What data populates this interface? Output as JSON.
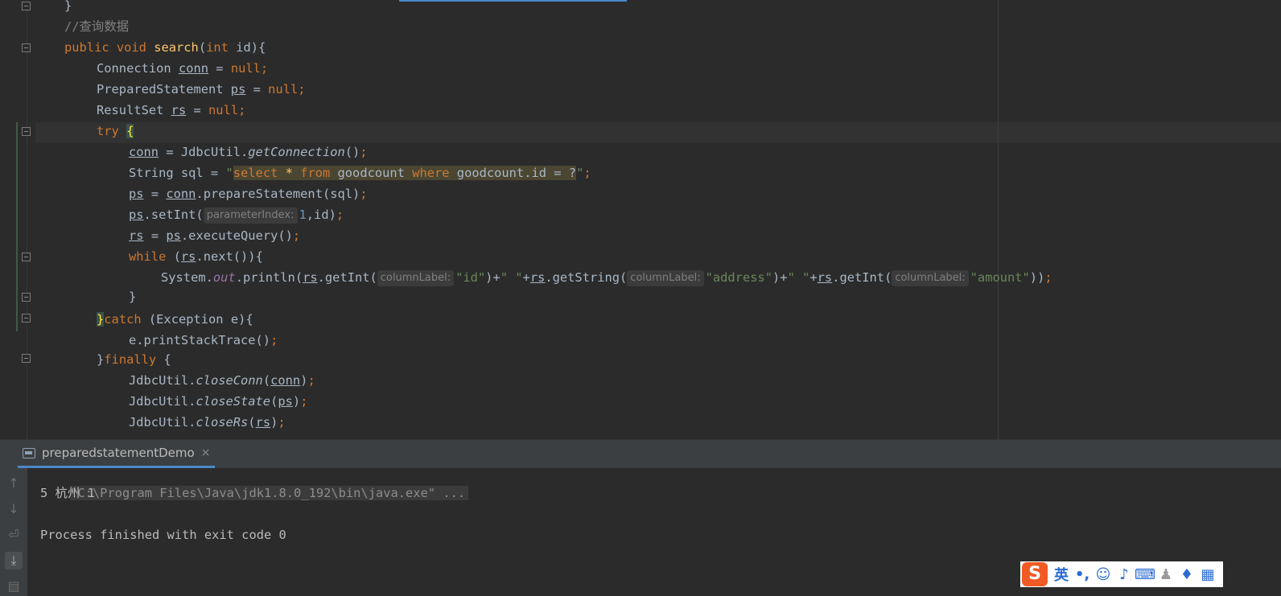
{
  "editor": {
    "lines": [
      {
        "id": "l0",
        "segments": [
          {
            "t": "}",
            "c": ""
          }
        ]
      },
      {
        "id": "l1",
        "segments": [
          {
            "t": "//查询数据",
            "c": "cm"
          }
        ]
      },
      {
        "id": "l2",
        "segments": [
          {
            "t": "public ",
            "c": "kw"
          },
          {
            "t": "void ",
            "c": "kw"
          },
          {
            "t": "search",
            "c": "fn"
          },
          {
            "t": "(",
            "c": ""
          },
          {
            "t": "int ",
            "c": "kw"
          },
          {
            "t": "id){",
            "c": ""
          }
        ]
      },
      {
        "id": "l3",
        "segments": [
          {
            "t": "Connection ",
            "c": ""
          },
          {
            "t": "conn",
            "c": "ul"
          },
          {
            "t": " = ",
            "c": ""
          },
          {
            "t": "null",
            "c": "kw"
          },
          {
            "t": ";",
            "c": "kw"
          }
        ]
      },
      {
        "id": "l4",
        "segments": [
          {
            "t": "PreparedStatement ",
            "c": ""
          },
          {
            "t": "ps",
            "c": "ul"
          },
          {
            "t": " = ",
            "c": ""
          },
          {
            "t": "null",
            "c": "kw"
          },
          {
            "t": ";",
            "c": "kw"
          }
        ]
      },
      {
        "id": "l5",
        "segments": [
          {
            "t": "ResultSet ",
            "c": ""
          },
          {
            "t": "rs",
            "c": "ul"
          },
          {
            "t": " = ",
            "c": ""
          },
          {
            "t": "null",
            "c": "kw"
          },
          {
            "t": ";",
            "c": "kw"
          }
        ]
      },
      {
        "id": "l6",
        "segments": [
          {
            "t": "try ",
            "c": "kw"
          },
          {
            "t": "{",
            "c": "brace-hl"
          }
        ]
      },
      {
        "id": "l7",
        "segments": [
          {
            "t": "conn",
            "c": "ul"
          },
          {
            "t": " = JdbcUtil.",
            "c": ""
          },
          {
            "t": "getConnection",
            "c": "it"
          },
          {
            "t": "()",
            "c": ""
          },
          {
            "t": ";",
            "c": "kw"
          }
        ]
      },
      {
        "id": "l8",
        "segments": [
          {
            "t": "String sql = ",
            "c": ""
          },
          {
            "t": "\"",
            "c": "str"
          },
          {
            "t": "select",
            "c": "sqlkw sql-bg"
          },
          {
            "t": " * ",
            "c": "sql-bg fnlike"
          },
          {
            "t": "from",
            "c": "sqlkw sql-bg"
          },
          {
            "t": " goodcount ",
            "c": "sql-bg"
          },
          {
            "t": "where",
            "c": "sqlkw sql-bg"
          },
          {
            "t": " goodcount.id = ?",
            "c": "sql-bg"
          },
          {
            "t": "\"",
            "c": "str"
          },
          {
            "t": ";",
            "c": "kw"
          }
        ]
      },
      {
        "id": "l9",
        "segments": [
          {
            "t": "ps",
            "c": "ul"
          },
          {
            "t": " = ",
            "c": ""
          },
          {
            "t": "conn",
            "c": "ul"
          },
          {
            "t": ".prepareStatement(sql)",
            "c": ""
          },
          {
            "t": ";",
            "c": "kw"
          }
        ]
      },
      {
        "id": "l10",
        "segments": [
          {
            "t": "ps",
            "c": "ul"
          },
          {
            "t": ".setInt(",
            "c": ""
          },
          {
            "t": "parameterIndex:",
            "c": "hint"
          },
          {
            "t": "1",
            "c": "num"
          },
          {
            "t": ",id)",
            "c": ""
          },
          {
            "t": ";",
            "c": "kw"
          }
        ]
      },
      {
        "id": "l11",
        "segments": [
          {
            "t": "rs",
            "c": "ul"
          },
          {
            "t": " = ",
            "c": ""
          },
          {
            "t": "ps",
            "c": "ul"
          },
          {
            "t": ".executeQuery()",
            "c": ""
          },
          {
            "t": ";",
            "c": "kw"
          }
        ]
      },
      {
        "id": "l12",
        "segments": [
          {
            "t": "while ",
            "c": "kw"
          },
          {
            "t": "(",
            "c": ""
          },
          {
            "t": "rs",
            "c": "ul"
          },
          {
            "t": ".next()){",
            "c": ""
          }
        ]
      },
      {
        "id": "l13",
        "segments": [
          {
            "t": "System.",
            "c": ""
          },
          {
            "t": "out",
            "c": "static"
          },
          {
            "t": ".println(",
            "c": ""
          },
          {
            "t": "rs",
            "c": "ul"
          },
          {
            "t": ".getInt(",
            "c": ""
          },
          {
            "t": "columnLabel:",
            "c": "hint"
          },
          {
            "t": "\"id\"",
            "c": "str"
          },
          {
            "t": ")+",
            "c": ""
          },
          {
            "t": "\" \"",
            "c": "str"
          },
          {
            "t": "+",
            "c": ""
          },
          {
            "t": "rs",
            "c": "ul"
          },
          {
            "t": ".getString(",
            "c": ""
          },
          {
            "t": "columnLabel:",
            "c": "hint"
          },
          {
            "t": "\"address\"",
            "c": "str"
          },
          {
            "t": ")+",
            "c": ""
          },
          {
            "t": "\" \"",
            "c": "str"
          },
          {
            "t": "+",
            "c": ""
          },
          {
            "t": "rs",
            "c": "ul"
          },
          {
            "t": ".getInt(",
            "c": ""
          },
          {
            "t": "columnLabel:",
            "c": "hint"
          },
          {
            "t": "\"amount\"",
            "c": "str"
          },
          {
            "t": "))",
            "c": ""
          },
          {
            "t": ";",
            "c": "kw"
          }
        ]
      },
      {
        "id": "l14",
        "segments": [
          {
            "t": "}",
            "c": ""
          }
        ]
      },
      {
        "id": "l15",
        "segments": [
          {
            "t": "}",
            "c": "brace-hl"
          },
          {
            "t": "catch ",
            "c": "kw"
          },
          {
            "t": "(Exception e){",
            "c": ""
          }
        ]
      },
      {
        "id": "l16",
        "segments": [
          {
            "t": "e.printStackTrace()",
            "c": ""
          },
          {
            "t": ";",
            "c": "kw"
          }
        ]
      },
      {
        "id": "l17",
        "segments": [
          {
            "t": "}",
            "c": ""
          },
          {
            "t": "finally ",
            "c": "kw"
          },
          {
            "t": "{",
            "c": ""
          }
        ]
      },
      {
        "id": "l18",
        "segments": [
          {
            "t": "JdbcUtil.",
            "c": ""
          },
          {
            "t": "closeConn",
            "c": "it"
          },
          {
            "t": "(",
            "c": ""
          },
          {
            "t": "conn",
            "c": "ul"
          },
          {
            "t": ")",
            "c": ""
          },
          {
            "t": ";",
            "c": "kw"
          }
        ]
      },
      {
        "id": "l19",
        "segments": [
          {
            "t": "JdbcUtil.",
            "c": ""
          },
          {
            "t": "closeState",
            "c": "it"
          },
          {
            "t": "(",
            "c": ""
          },
          {
            "t": "ps",
            "c": "ul"
          },
          {
            "t": ")",
            "c": ""
          },
          {
            "t": ";",
            "c": "kw"
          }
        ]
      },
      {
        "id": "l20",
        "segments": [
          {
            "t": "JdbcUtil.",
            "c": ""
          },
          {
            "t": "closeRs",
            "c": "it"
          },
          {
            "t": "(",
            "c": ""
          },
          {
            "t": "rs",
            "c": "ul"
          },
          {
            "t": ")",
            "c": ""
          },
          {
            "t": ";",
            "c": "kw"
          }
        ]
      }
    ]
  },
  "run_panel": {
    "tab_label": "preparedstatementDemo",
    "tab_close": "×",
    "side_icons": [
      "arrow-up-icon",
      "arrow-down-icon",
      "soft-wrap-icon",
      "scroll-to-end-icon",
      "print-icon"
    ],
    "console": {
      "command": "\"C:\\Program Files\\Java\\jdk1.8.0_192\\bin\\java.exe\" ...",
      "output": "5 杭州 1",
      "exit": "Process finished with exit code 0"
    }
  },
  "ime_toolbar": {
    "logo": "S",
    "lang": "英",
    "punct": "•,",
    "icons": [
      "emoji-icon",
      "microphone-icon",
      "keyboard-icon",
      "user-icon",
      "skin-icon",
      "grid-icon"
    ]
  },
  "colors": {
    "editor_bg": "#2b2b2b",
    "keyword": "#cc7832",
    "string": "#6a8759",
    "number": "#6897bb",
    "function": "#ffc66d",
    "default_text": "#a9b7c6",
    "accent": "#4a88c7"
  }
}
